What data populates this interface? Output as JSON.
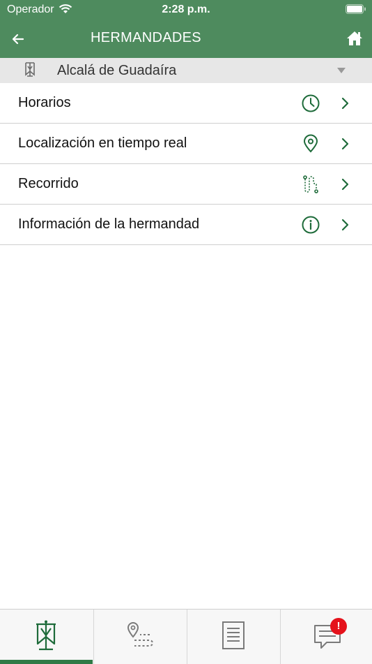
{
  "status_bar": {
    "carrier": "Operador",
    "time": "2:28 p.m."
  },
  "header": {
    "title": "HERMANDADES"
  },
  "city_selector": {
    "selected": "Alcalá de Guadaíra"
  },
  "menu": {
    "items": [
      {
        "label": "Horarios",
        "icon": "clock-icon"
      },
      {
        "label": "Localización en tiempo real",
        "icon": "location-pin-icon"
      },
      {
        "label": "Recorrido",
        "icon": "route-icon"
      },
      {
        "label": "Información de la hermandad",
        "icon": "info-icon"
      }
    ]
  },
  "tab_bar": {
    "tabs": [
      {
        "icon": "brotherhood-banner-icon",
        "active": true
      },
      {
        "icon": "route-map-icon",
        "active": false
      },
      {
        "icon": "document-icon",
        "active": false
      },
      {
        "icon": "chat-icon",
        "active": false
      }
    ],
    "badge": "!"
  },
  "colors": {
    "header": "#4e8b5e",
    "accent": "#2f7a46",
    "icon_green": "#1e6b3a",
    "badge": "#e5121b"
  }
}
